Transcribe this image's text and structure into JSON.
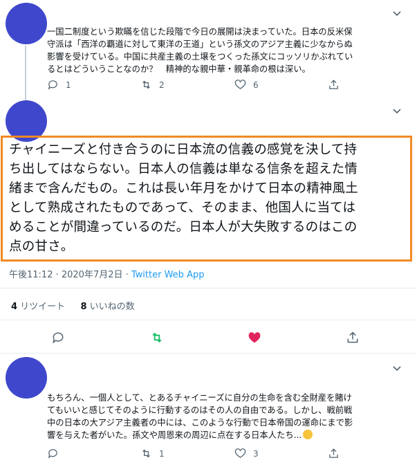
{
  "tweet1": {
    "text_lines": [
      "一国二制度という欺瞞を信じた段階で今日の展開は決まっていた。日本の反米保",
      "守派は「西洋の覇道に対して東洋の王道」という孫文のアジア主義に少なからぬ",
      "影響を受けている。中国に共産主義の土壌をつくった孫文にコッソリかぶれてい",
      "るとはどういうことなのか？　精神的な親中華・親革命の根は深い。"
    ],
    "reply_count": "1",
    "retweet_count": "2",
    "like_count": "6"
  },
  "main_tweet": {
    "text_lines": [
      "チャイニーズと付き合うのに日本流の信義の感覚を決して持",
      "ち出してはならない。日本人の信義は単なる信条を超えた情",
      "緒まで含んだもの。これは長い年月をかけて日本の精神風土",
      "として熟成されたものであって、そのまま、他国人に当ては",
      "めることが間違っているのだ。日本人が大失敗するのはこの",
      "点の甘さ。"
    ],
    "timestamp": "午後11:12 · 2020年7月2日 · ",
    "source": "Twitter Web App",
    "retweets_num": "4",
    "retweets_label": " リツイート",
    "likes_num": "8",
    "likes_label": " いいねの数",
    "accent_color": "#f08a24",
    "liked_color": "#e0245e",
    "retweet_color": "#17bf63"
  },
  "tweet3": {
    "text_lines": [
      "もちろん、一個人として、とあるチャイニーズに自分の生命を含む全財産を賭け",
      "てもいいと感じてそのように行動するのはその人の自由である。しかし、戦前戦",
      "中の日本の大アジア主義者の中には、このような行動で日本帝国の運命にまで影",
      "響を与えた者がいた。孫文や周恩来の周辺に点在する日本人たち..."
    ],
    "reply_count": "",
    "retweet_count": "1",
    "like_count": "3"
  },
  "icons": [
    "chevron-down-icon",
    "reply-icon",
    "retweet-icon",
    "like-icon",
    "share-icon",
    "emoji-icon"
  ]
}
